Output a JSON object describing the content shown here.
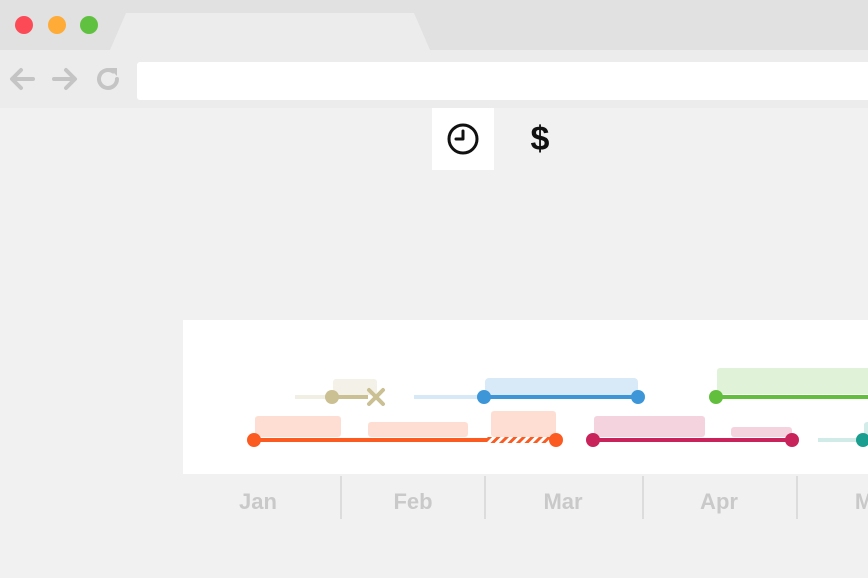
{
  "window": {
    "traffic_lights": [
      {
        "name": "close-button",
        "color": "#fc4b57"
      },
      {
        "name": "minimize-button",
        "color": "#ffab37"
      },
      {
        "name": "zoom-button",
        "color": "#60c140"
      }
    ],
    "address_bar": {
      "value": ""
    }
  },
  "toolbar": {
    "modes": [
      {
        "name": "time-mode-button",
        "icon": "clock-icon",
        "active": true
      },
      {
        "name": "cost-mode-button",
        "icon": "dollar-icon",
        "label": "$",
        "active": false
      }
    ]
  },
  "timeline": {
    "months": [
      "Jan",
      "Feb",
      "Mar",
      "Apr",
      "M"
    ],
    "colors": {
      "tan": "#cbbf94",
      "blue": "#3d96d8",
      "green": "#62bf3d",
      "orange": "#fb5b21",
      "pink": "#c8245b",
      "teal": "#1a9e8f"
    }
  }
}
